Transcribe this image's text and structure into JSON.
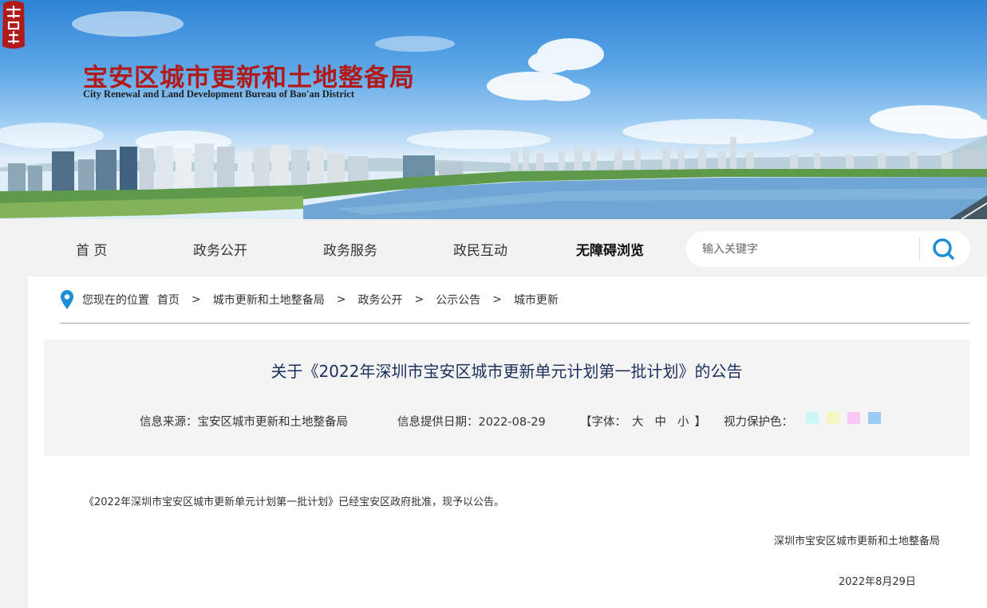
{
  "header": {
    "logo_title_cn": "宝安区城市更新和土地整备局",
    "logo_title_en": "City Renewal and Land Development Bureau  of Bao'an District"
  },
  "nav": {
    "items": [
      {
        "label": "首 页"
      },
      {
        "label": "政务公开"
      },
      {
        "label": "政务服务"
      },
      {
        "label": "政民互动"
      },
      {
        "label": "无障碍浏览"
      }
    ],
    "search": {
      "placeholder": "输入关键字",
      "value": ""
    }
  },
  "breadcrumb": {
    "prefix": "您现在的位置",
    "separator": ">",
    "items": [
      "首页",
      "城市更新和土地整备局",
      "政务公开",
      "公示公告",
      "城市更新"
    ]
  },
  "article": {
    "title": "关于《2022年深圳市宝安区城市更新单元计划第一批计划》的公告",
    "source_label": "信息来源：",
    "source_value": "宝安区城市更新和土地整备局",
    "date_label": "信息提供日期：",
    "date_value": "2022-08-29",
    "font_open": "【字体：",
    "font_sizes": [
      "大",
      "中",
      "小"
    ],
    "font_close": "】",
    "eye_label": "视力保护色：",
    "eye_colors": [
      "#ccf5f6",
      "#f5f5c0",
      "#f9c7f4",
      "#9ccbf5"
    ],
    "body": "《2022年深圳市宝安区城市更新单元计划第一批计划》已经宝安区政府批准，现予以公告。",
    "signature": "深圳市宝安区城市更新和土地整备局",
    "sign_date": "2022年8月29日"
  },
  "colors": {
    "brand_red": "#b01a1a",
    "title_navy": "#1c2f5c",
    "accent_blue": "#1d8fd8"
  }
}
